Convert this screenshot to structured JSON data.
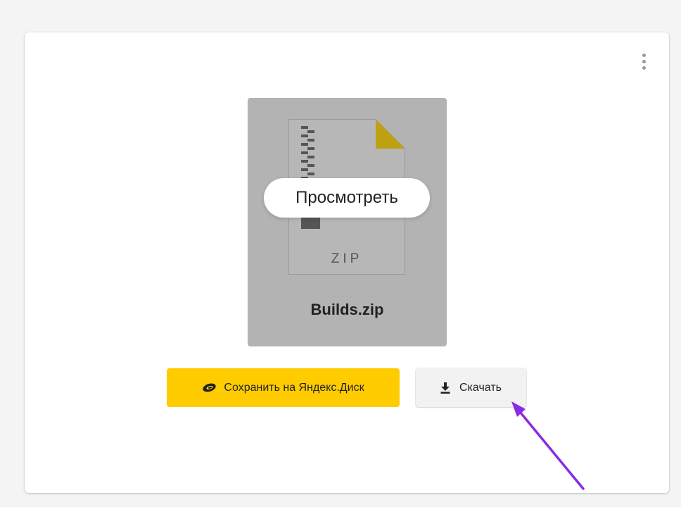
{
  "preview": {
    "view_label": "Просмотреть",
    "file_name": "Builds.zip",
    "file_type_label": "ZIP",
    "icon": "zip-file-icon"
  },
  "actions": {
    "save_label": "Сохранить на Яндекс.Диск",
    "save_icon": "yandex-disk-icon",
    "download_label": "Скачать",
    "download_icon": "download-icon"
  },
  "menu": {
    "icon": "more-vertical-icon"
  },
  "colors": {
    "save_button": "#ffcc00",
    "preview_background": "#b3b3b3",
    "file_corner": "#bfa010",
    "annotation_arrow": "#8a2be2"
  }
}
